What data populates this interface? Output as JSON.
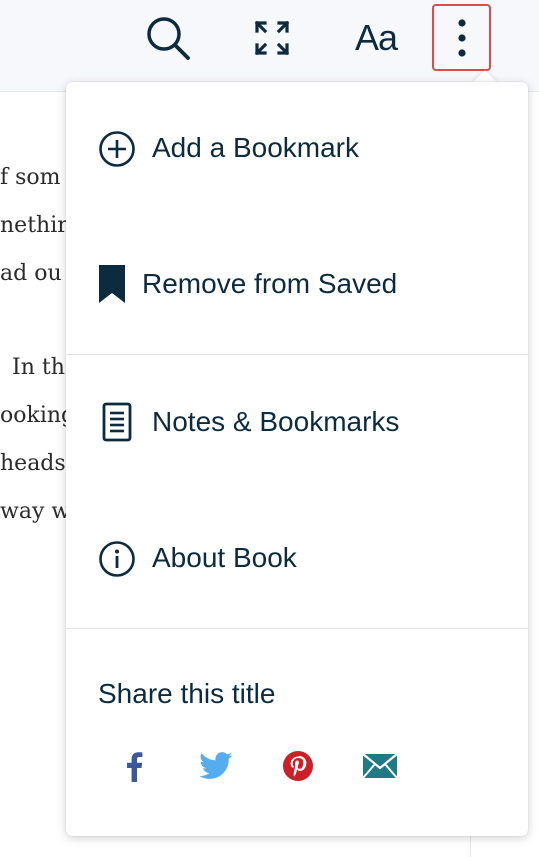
{
  "toolbar": {
    "search_icon": "search-icon",
    "expand_icon": "fullscreen-icon",
    "font_label": "Aa",
    "more_icon": "more-vertical-icon"
  },
  "background_text": {
    "lines": [
      "f som",
      "nethir",
      "ad ou",
      "In th",
      "ooking",
      "heads",
      "way w"
    ]
  },
  "menu": {
    "items": [
      {
        "label": "Add a Bookmark",
        "icon": "plus-circle-icon"
      },
      {
        "label": "Remove from Saved",
        "icon": "bookmark-icon"
      },
      {
        "label": "Notes & Bookmarks",
        "icon": "notes-icon"
      },
      {
        "label": "About Book",
        "icon": "info-icon"
      }
    ],
    "share": {
      "title": "Share this title",
      "buttons": [
        {
          "name": "facebook",
          "icon": "facebook-icon",
          "color": "#3b5998"
        },
        {
          "name": "twitter",
          "icon": "twitter-icon",
          "color": "#55acee"
        },
        {
          "name": "pinterest",
          "icon": "pinterest-icon",
          "color": "#cb2027"
        },
        {
          "name": "email",
          "icon": "email-icon",
          "color": "#1f7a86"
        }
      ]
    }
  },
  "colors": {
    "text": "#0d2b3e",
    "highlight_border": "#e24a4a",
    "toolbar_bg": "#f7f8fb"
  }
}
